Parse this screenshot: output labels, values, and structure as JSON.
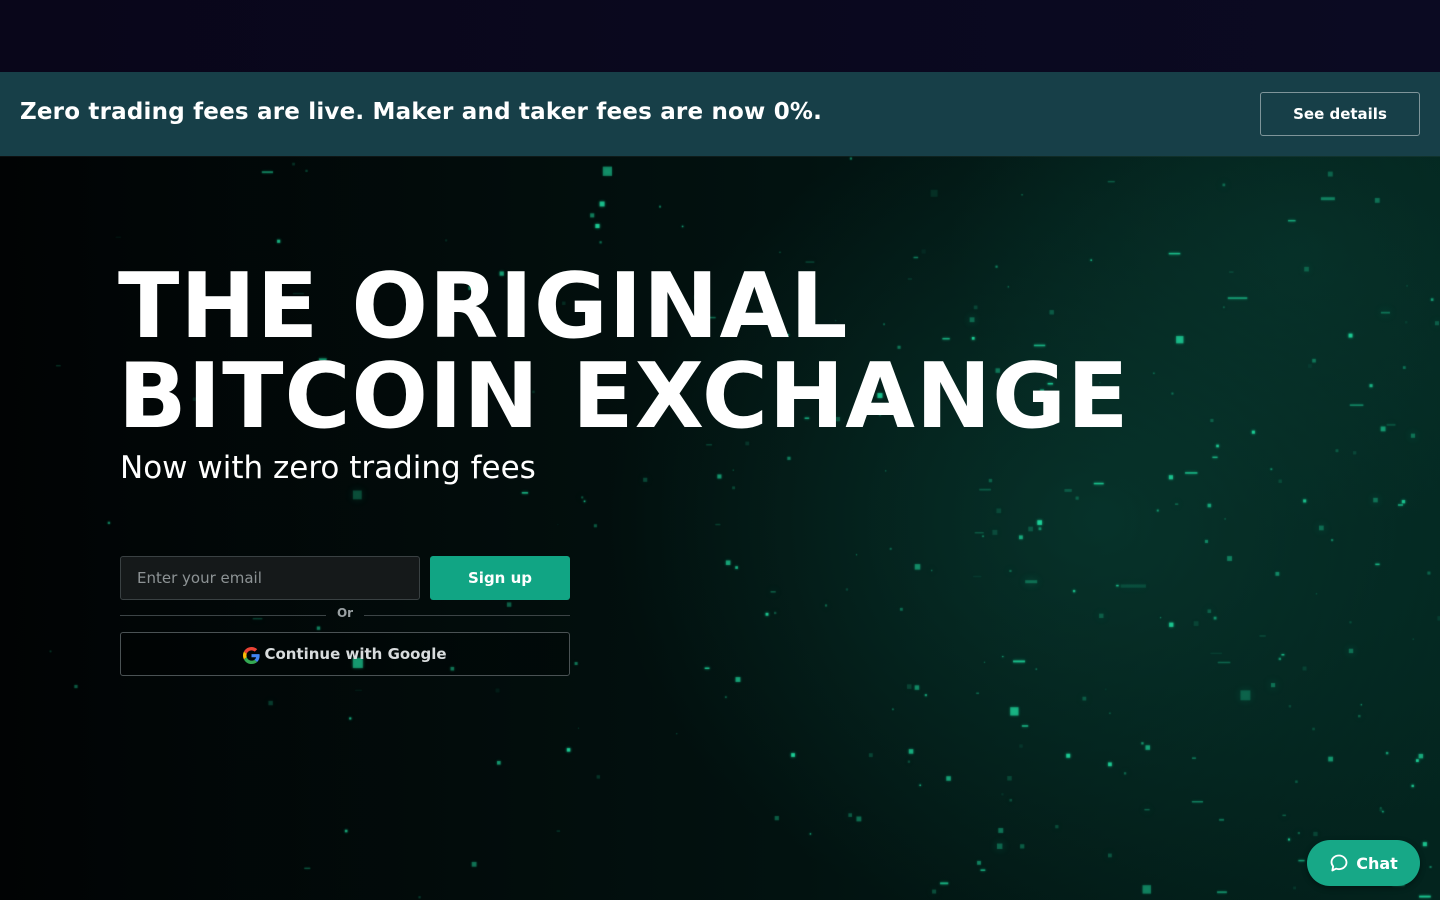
{
  "banner": {
    "message": "Zero trading fees are live. Maker and taker fees are now 0%.",
    "details_label": "See details"
  },
  "hero": {
    "title_line1": "THE ORIGINAL",
    "title_line2": "BITCOIN EXCHANGE",
    "subtitle": "Now with zero trading fees"
  },
  "signup": {
    "email_placeholder": "Enter your email",
    "signup_label": "Sign up",
    "divider_label": "Or",
    "google_label": "Continue with Google"
  },
  "chat": {
    "label": "Chat"
  },
  "colors": {
    "accent": "#11a584",
    "banner_bg": "#173f48",
    "particle": "#1fd99e"
  }
}
